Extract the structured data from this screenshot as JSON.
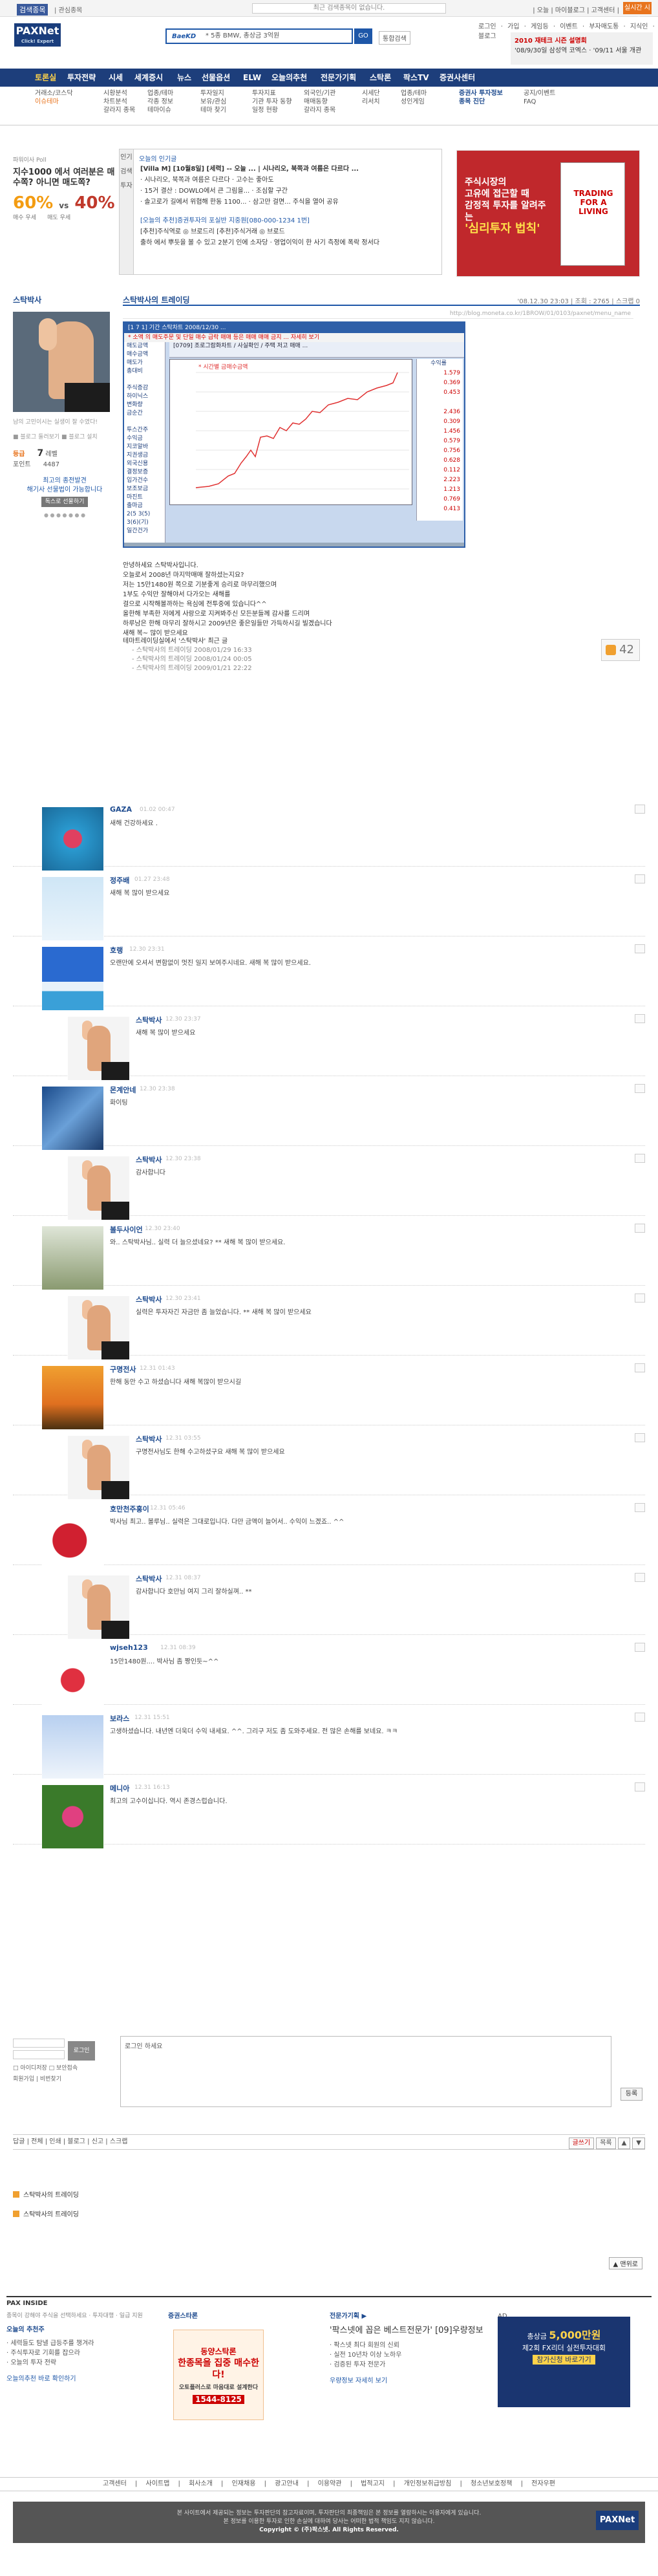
{
  "topbar": {
    "tab": "검색종목",
    "sub": "| 관심종목",
    "notice": "최근 검색종목이 없습니다.",
    "right": "| 오늘 | 마이블로그 | 고객센터 |",
    "quote_btn": "실시간 시세"
  },
  "header": {
    "logo": "PAXNet",
    "logo_sub": "Click! Expert",
    "search_brand": "BaeKD",
    "search_text": "* 5종 BMW, 총상금 3억원",
    "search_btn": "GO",
    "int_search": "통합검색",
    "util": "로그인 · 가입 · 게임등 · 이벤트 · 부자매도통 · 지식인 · 블로그",
    "promo_title": "2010 재테크 시즌 설명회",
    "promo_text": "'08/9/30일 삼성역 코엑스 · '09/11 서울 개관"
  },
  "nav": [
    "토론실",
    "투자전략",
    "시세",
    "세계증시",
    "뉴스",
    "선물옵션",
    "ELW",
    "오늘의추천",
    "전문가기획",
    "스탁론",
    "팍스TV",
    "증권사센터"
  ],
  "subnav": {
    "c1": [
      "거래소/코스닥",
      "이슈테마"
    ],
    "c2": [
      "시황분석",
      "차트분석",
      "갈라지 종목"
    ],
    "c3": [
      "업종/테마",
      "각종 정보",
      "테마이슈"
    ],
    "c4": [
      "투자일지",
      "보유/관심",
      "테마 찾기"
    ],
    "c5": [
      "투자지표",
      "기관 투자 동향",
      "일정 현황"
    ],
    "c6": [
      "외국인/기관",
      "매매동향",
      "갈라지 종목"
    ],
    "c7": [
      "시세단",
      "리서치"
    ],
    "c8": [
      "업종/테마",
      "성인게임"
    ],
    "c9": [
      "증권사 투자정보",
      "종목 진단"
    ],
    "c10": [
      "공지/이벤트",
      "FAQ"
    ]
  },
  "poll": {
    "label": "파워이사 Poll",
    "question": "지수1000 에서 여러분은 매수쪽? 아니면 매도쪽?",
    "left_pct": "60%",
    "vs": "vs",
    "right_pct": "40%",
    "left_lbl": "매수 우세",
    "right_lbl": "매도 우세"
  },
  "hot": {
    "tabs": [
      "인기",
      "검색",
      "투자"
    ],
    "title": "오늘의 인기글",
    "rows": [
      "[Villa M] [10월8일] [세력] -- 오늘 ... | 시나리오, 북쪽과 여름은 다르다 ...",
      "· 시나리오, 북쪽과 여름은 다르다 · 고수는 좋아도",
      "· 15거 결산 : DOWLO에서 큰 그림을... · 조심할 구간",
      "· 솔고로가 길에서 위협해 한동 1100... · 삼고만 걸면... 주식을 열어 공유",
      "[오늘의 추천]증권투자의 포실반 지중원[080-000-1234 1번]",
      "[추천]주식역로 ◎ 브로드리   [추천]주식거래 ◎ 브로드",
      "출하 에서 뿌듯을 볼 수 있고 2분기 인에 소자당 · 영업이익이 한 사기 측정에 폭락 정서다"
    ]
  },
  "ad": {
    "line1": "주식시장의",
    "line2": "고유에 접근할 때",
    "line3": "감정적 투자를 알려주는",
    "hl": "'심리투자 법칙'",
    "book": "TRADING FOR A LIVING"
  },
  "profile": {
    "nick": "스탁박사",
    "intro": "남의 고민이시는 실생이 잘 수였다!",
    "links": "■ 블로그 둘러보기 ■ 블로그 설치",
    "level_lbl": "등급",
    "level": "7",
    "level_unit": "레벨",
    "points_lbl": "포인트",
    "points": "4487",
    "notice1": "최고의 종전발견",
    "notice2": "해기사 선물법이 가능합니다",
    "notice_btn": "독스로 선물하기"
  },
  "post": {
    "title": "스탁박사의 트레이딩",
    "meta": "'08.12.30 23:03 | 조회 : 2765 | 스크랩 0",
    "url": "http://blog.moneta.co.kr/1BROW/01/0103/paxnet/menu_name",
    "chart": {
      "window_title": "[1 7 1] 기간 스탁차트 2008/12/30 ...",
      "warning": "* 소액 의 매도주문 및 단일 매수 급락 매매 등은 매매 매매 금지 ... 자세히 보기",
      "subtitle": "[0709] 조로그람화차트 / 사실확인 / 주택 저고 매매 ...",
      "legend": "* 시간별 금매수금액",
      "table": [
        "매도금액",
        "매수금액",
        "매도가",
        "총대비",
        "",
        "주식증감",
        "하이닉스",
        "변화량",
        "금순간",
        "",
        "투스간주",
        "수익금",
        "지코알바",
        "지권생금",
        "외국신용",
        "결정보증",
        "입가건수",
        "보조보금",
        "마진트",
        "출마금",
        "2(5 3(5)",
        "3(6)(기)",
        "일간건가"
      ],
      "right_hd": "수익률",
      "right": [
        "1.579",
        "0.369",
        "0.453",
        "",
        "2.436",
        "0.309",
        "1.456",
        "0.579",
        "0.756",
        "0.628",
        "0.112",
        "2.223",
        "1.213",
        "0.769",
        "0.413"
      ]
    },
    "body": [
      "안녕하세요 스탁박사입니다.",
      "오늘로서 2008년 마지막매매 잘하셨는지요?",
      "저는 15만1480원 쪽으로 기분좋게 승리로 마무리했으며",
      "1부도 수익만 잘해야서 다가오는 새해를",
      "걸으로 시작해볼까하는 욕심에 전투중에 있습니다^^",
      "올한해 부족한 저에게 사랑으로 지켜봐주신 모든분들께 감사를 드리며",
      "하루남은 한해 마무리 잘하시고 2009년은 좋은일들만 가득하시길 빌겠습니다",
      "새해 복~ 많이 받으세요"
    ],
    "related_head": "테마트레이딩실에서 '스탁박사' 최근 글",
    "related": [
      "- 스탁박사의 트레이딩    2008/01/29 16:33",
      "- 스탁박사의 트레이딩    2008/01/24 00:05",
      "- 스탁박사의 트레이딩    2009/01/21 22:22"
    ],
    "likes": "42"
  },
  "comments": [
    {
      "name": "GAZA",
      "time": "01.02 00:47",
      "text": "새해 건강하세요 .",
      "img": "water"
    },
    {
      "name": "정주배",
      "time": "01.27 23:48",
      "text": "새해 복 많이 받으세요",
      "img": "bird"
    },
    {
      "name": "호랭",
      "time": "12.30 23:31",
      "text": "오랜만에 오셔서 변함없이 멋진 일지 보여주시네요. 새해 복 많이 받으세요.",
      "img": "sky"
    },
    {
      "name": "스탁박사",
      "time": "12.30 23:37",
      "text": "새해 복 많이 받으세요",
      "img": "hand"
    },
    {
      "name": "몬계안네",
      "time": "12.30 23:38",
      "text": "화이팅",
      "img": "building"
    },
    {
      "name": "스탁박사",
      "time": "12.30 23:38",
      "text": "감사합니다",
      "img": "hand"
    },
    {
      "name": "볼두사이언",
      "time": "12.30 23:40",
      "text": "와.. 스탁박사님.. 실력 더 늘으셨네요? ** 새해 복 많이 받으세요.",
      "img": "sparrow"
    },
    {
      "name": "스탁박사",
      "time": "12.30 23:41",
      "text": "실력은 투자자긴 자금만 좀 늘었습니다. ** 새해 복 많이 받으세요",
      "img": "hand"
    },
    {
      "name": "구명전사",
      "time": "12.31 01:43",
      "text": "한해 동안 수고 하셨습니다 새해 복많이 받으시길",
      "img": "sunset"
    },
    {
      "name": "스탁박사",
      "time": "12.31 03:55",
      "text": "구명전사님도 한해 수고하셨구요 새해 복 많이 받으세요",
      "img": "hand"
    },
    {
      "name": "호만천주홍이",
      "time": "12.31 05:46",
      "text": "박사님 최고.. 볼루님.. 실력은 그대로입니다. 다만 금액이 늘어서.. 수익이 느겠죠.. ^^",
      "img": "gift"
    },
    {
      "name": "스탁박사",
      "time": "12.31 08:37",
      "text": "감사합니다 호만님 여지 그리 잘하실껴.. **",
      "img": "hand"
    },
    {
      "name": "wjseh123",
      "time": "12.31 08:39",
      "text": "15만1480원.... 박사님 좀 짱인듯~^^",
      "img": "heart"
    },
    {
      "name": "보라스",
      "time": "12.31 15:51",
      "text": "고생하셨습니다. 내년엔 더욱더 수익 내세요. ^^. 그리구 저도 좀 도와주세요. 전 많은 손해를 보네요. ㅋㅋ",
      "img": "girl"
    },
    {
      "name": "메니아",
      "time": "12.31 16:13",
      "text": "최고의 고수이십니다. 역시 존경스럽습니다.",
      "img": "flower"
    }
  ],
  "write": {
    "id_lbl": "ID",
    "pw_lbl": "PW",
    "login_btn": "로그인",
    "opts": "□ 아이디저장 □ 보안접속",
    "links": "회원가입 | 비번찾기",
    "placeholder": "로그인 하세요",
    "register": "등록"
  },
  "postnav": {
    "left": "답글 | 전체 | 인쇄 | 블로그 | 신고 | 스크랩",
    "btns": [
      "글쓰기",
      "목록",
      "▲",
      "▼"
    ]
  },
  "postlist": [
    "스탁박사의 트레이딩",
    "스탁박사의 트레이딩"
  ],
  "topbtn": "▲ 맨위로",
  "pax": {
    "head": "PAX INSIDE",
    "c1_title": "오늘의 추천주",
    "c1": [
      "· 세력들도 탐낼 급등주를 챙겨라",
      "· 주식투자로 기회를 잡으라",
      "· 오늘의 투자 전략"
    ],
    "c1_link": "오늘의추천 바로 확인하기",
    "c1_sub": "종목이 강해야 주식을 선택하세요 · 투자대행 · 일급 지원",
    "c2_title": "증권스타론",
    "stock1": "동양스탁론",
    "stock2": "한종목을 집중 매수한다!",
    "stock3": "오토플러스로 마음대로 설계한다",
    "stock_tel": "1544-8125",
    "c3_title": "전문가기획 ▶",
    "c3_main": "'팍스넷에 꼽은 베스트전문가' [09]우량정보",
    "c3": [
      "· 팍스넷 최다 회원의 신뢰",
      "· 실전 10년차 이상 노하우",
      "· 검증된 투자 전문가"
    ],
    "c3_link": "우량정보 자세히 보기",
    "ad_label": "AD",
    "banner1": "총상금",
    "banner2": "5,000만원",
    "banner3": "제2회 FX리더 실전투자대회",
    "banner4": "참가신청 바로가기"
  },
  "footer": {
    "links": "고객센터 | 사이트맵 | 회사소개 | 인재채용 | 광고안내 | 이용약관 | 법적고지 | 개인정보취급방침 | 청소년보호정책 | 전자우편",
    "line1": "본 사이트에서 제공되는 정보는 투자판단의 참고자료이며, 투자판단의 최종책임은 본 정보를 열람하시는 이용자에게 있습니다.",
    "line2": "본 정보를 이용한 투자로 인한 손실에 대하여 당사는 어떠한 법적 책임도 지지 않습니다.",
    "line3": "Copyright © (주)팍스넷. All Rights Reserved.",
    "logo": "PAXNet"
  },
  "colors": {
    "brand": "#1d3e7b",
    "accent": "#e8741e",
    "link": "#1e4b8f"
  }
}
